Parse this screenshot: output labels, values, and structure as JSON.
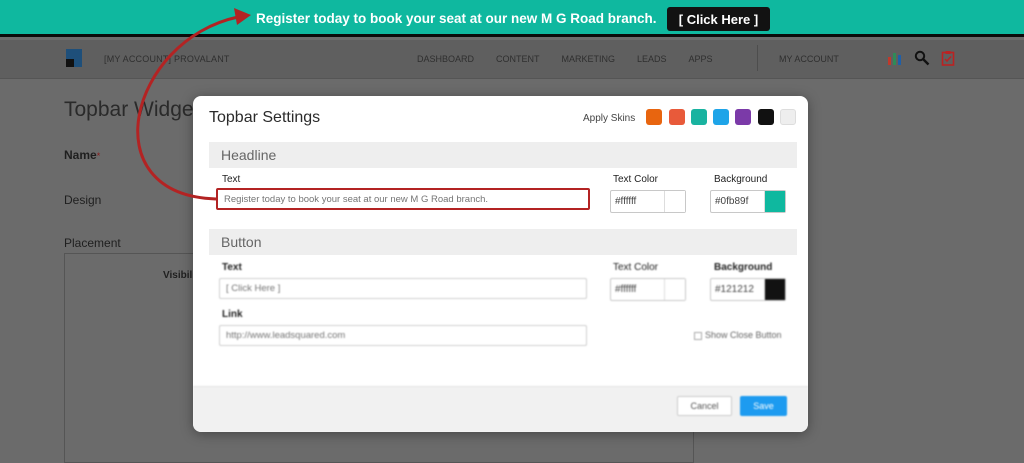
{
  "topbar": {
    "message": "Register today to book your seat at our new M G Road branch.",
    "button_label": "[ Click Here ]",
    "background": "#0fb89f"
  },
  "app_header": {
    "account_menu": "[MY ACCOUNT] PROVALANT",
    "nav_items": [
      "DASHBOARD",
      "CONTENT",
      "MARKETING",
      "LEADS",
      "APPS"
    ],
    "my_account": "MY ACCOUNT",
    "icons": [
      "bar-chart-icon",
      "search-icon",
      "clipboard-icon"
    ]
  },
  "page": {
    "title": "Topbar Widget",
    "labels": {
      "name": "Name",
      "required_mark": "*",
      "design": "Design",
      "placement": "Placement",
      "visibility": "Visibili"
    }
  },
  "modal": {
    "title": "Topbar Settings",
    "apply_skins_label": "Apply Skins",
    "skins": [
      "#e8650f",
      "#e85a3a",
      "#19b3a0",
      "#1ea4e8",
      "#7b3aa8",
      "#111111",
      "#eeeeee"
    ],
    "headline": {
      "section_title": "Headline",
      "text_label": "Text",
      "text_placeholder": "Register today to book your seat at our new M G Road branch.",
      "text_color_label": "Text Color",
      "text_color_value": "#ffffff",
      "background_label": "Background",
      "background_value": "#0fb89f"
    },
    "button": {
      "section_title": "Button",
      "text_label": "Text",
      "text_placeholder": "[ Click Here ]",
      "text_color_label": "Text Color",
      "text_color_value": "#ffffff",
      "background_label": "Background",
      "background_value": "#121212",
      "link_label": "Link",
      "link_placeholder": "http://www.leadsquared.com",
      "show_close_label": "Show Close Button"
    },
    "footer": {
      "cancel_label": "Cancel",
      "save_label": "Save"
    }
  }
}
